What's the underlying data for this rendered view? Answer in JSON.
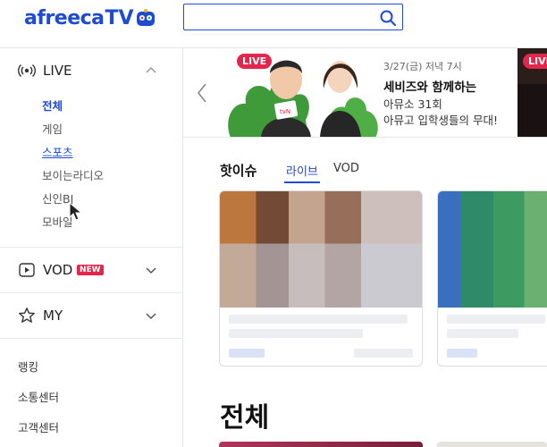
{
  "header": {
    "logo_text": "afreeca",
    "logo_tv": "TV",
    "search_placeholder": ""
  },
  "sidebar": {
    "live_label": "LIVE",
    "live_items": [
      "전체",
      "게임",
      "스포츠",
      "보이는라디오",
      "신인BJ",
      "모바일"
    ],
    "vod_label": "VOD",
    "vod_badge": "NEW",
    "my_label": "MY",
    "extra_items": [
      "랭킹",
      "소통센터",
      "고객센터"
    ]
  },
  "banner": {
    "live_badge": "LIVE",
    "date": "3/27(금) 저녁 7시",
    "title": "세비즈와 함께하는",
    "sub1": "아뮤소 31회",
    "sub2": "아뮤고 입학생들의 무대!",
    "live_badge_2": "LIVE"
  },
  "hot": {
    "title": "핫이슈",
    "tabs": [
      "라이브",
      "VOD"
    ]
  },
  "main": {
    "section_title": "전체"
  },
  "colors": {
    "brand": "#1e4bd1",
    "live": "#e5264c"
  }
}
